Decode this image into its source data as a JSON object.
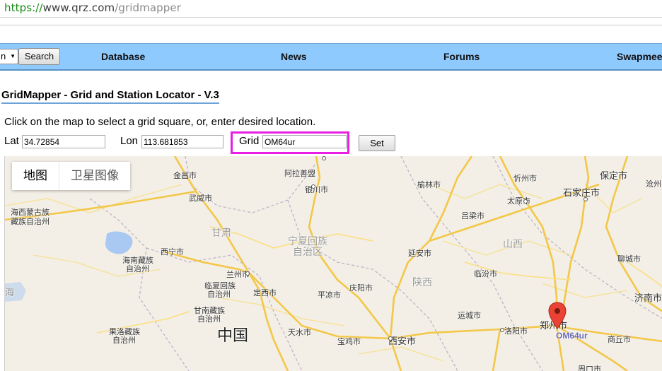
{
  "browser": {
    "url_protocol": "https://",
    "url_host": "www.qrz.com",
    "url_path": "/gridmapper"
  },
  "nav": {
    "select_value": "n",
    "search_label": "Search",
    "items": [
      "Database",
      "News",
      "Forums",
      "Swapmee"
    ]
  },
  "page": {
    "title": "GridMapper - Grid and Station Locator - V.3",
    "instruction": "Click on the map to select a grid square, or, enter desired location.",
    "lat_label": "Lat",
    "lat_value": "34.72854",
    "lon_label": "Lon",
    "lon_value": "113.681853",
    "grid_label": "Grid",
    "grid_value": "OM64ur",
    "set_label": "Set"
  },
  "map": {
    "tabs": [
      "地图",
      "卫星图像"
    ],
    "marker_label": "OM64ur",
    "marker_city": "郑州市",
    "places": {
      "jinchang": "金昌市",
      "alashan": "阿拉善盟",
      "yinchuan": "银川市",
      "yulin": "榆林市",
      "xinzhou": "忻州市",
      "baoding": "保定市",
      "wuwei": "武威市",
      "taiyuan": "太原市",
      "shijiazhuang": "石家庄市",
      "cangzhou": "沧州",
      "haixi1": "海西蒙古族",
      "haixi2": "藏族自治州",
      "gansu": "甘肃",
      "ningxia1": "宁夏回族",
      "ningxia2": "自治区",
      "lvliang": "吕梁市",
      "shanxi_prov": "山西",
      "xining": "西宁市",
      "haina1": "海南藏族",
      "haina2": "自治州",
      "yanan": "延安市",
      "liaocheng": "聊城市",
      "lanzhou": "兰州市",
      "linxia1": "临夏回族",
      "linxia2": "自治州",
      "dingxi": "定西市",
      "pingliang": "平凉市",
      "qingyang": "庆阳市",
      "shaanxi_prov": "陕西",
      "linfen": "临汾市",
      "jinan": "济南市",
      "sea": "海",
      "gannan1": "甘南藏族",
      "gannan2": "自治州",
      "yuncheng": "运城市",
      "guoluo1": "果洛藏族",
      "guoluo2": "自治州",
      "china": "中国",
      "tianshui": "天水市",
      "baoji": "宝鸡市",
      "xian": "西安市",
      "luoyang": "洛阳市",
      "shangqiu": "商丘市",
      "zhoukou": "周口市"
    }
  }
}
